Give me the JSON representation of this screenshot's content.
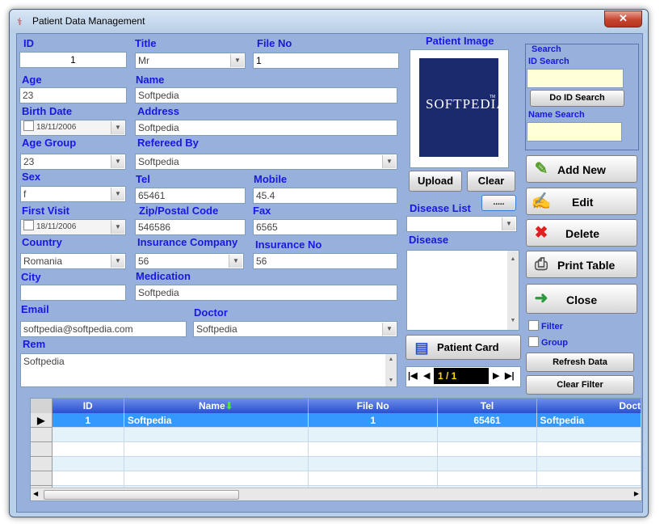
{
  "window": {
    "title": "Patient Data Management",
    "close_glyph": "✕"
  },
  "form": {
    "id": {
      "label": "ID",
      "value": "1"
    },
    "title": {
      "label": "Title",
      "value": "Mr"
    },
    "file_no": {
      "label": "File No",
      "value": "1"
    },
    "age": {
      "label": "Age",
      "value": "23"
    },
    "name": {
      "label": "Name",
      "value": "Softpedia"
    },
    "birth_date": {
      "label": "Birth Date",
      "value": "18/11/2006"
    },
    "address": {
      "label": "Address",
      "value": "Softpedia"
    },
    "age_group": {
      "label": "Age Group",
      "value": "23"
    },
    "refereed_by": {
      "label": "Refereed By",
      "value": "Softpedia"
    },
    "sex": {
      "label": "Sex",
      "value": "f"
    },
    "tel": {
      "label": "Tel",
      "value": "65461"
    },
    "mobile": {
      "label": "Mobile",
      "value": "45.4"
    },
    "first_visit": {
      "label": "First Visit",
      "value": "18/11/2006"
    },
    "zip": {
      "label": "Zip/Postal Code",
      "value": "546586"
    },
    "fax": {
      "label": "Fax",
      "value": "6565"
    },
    "country": {
      "label": "Country",
      "value": "Romania"
    },
    "insurance_company": {
      "label": "Insurance Company",
      "value": "56"
    },
    "insurance_no": {
      "label": "Insurance No",
      "value": "56"
    },
    "city": {
      "label": "City",
      "value": ""
    },
    "medication": {
      "label": "Medication",
      "value": "Softpedia"
    },
    "email": {
      "label": "Email",
      "value": "softpedia@softpedia.com"
    },
    "doctor": {
      "label": "Doctor",
      "value": "Softpedia"
    },
    "rem": {
      "label": "Rem",
      "value": "Softpedia"
    }
  },
  "patient_image": {
    "label": "Patient Image",
    "logo_text": "SOFTPEDIA",
    "logo_mark": "TM",
    "upload": "Upload",
    "clear": "Clear",
    "more": "....."
  },
  "disease": {
    "list_label": "Disease List",
    "label": "Disease",
    "list_value": ""
  },
  "patient_card": {
    "label": "Patient Card"
  },
  "navigator": {
    "page": "1 / 1"
  },
  "search": {
    "group_label": "Search",
    "id_label": "ID Search",
    "id_value": "",
    "do_id_search": "Do ID Search",
    "name_label": "Name Search",
    "name_value": ""
  },
  "actions": {
    "add_new": "Add New",
    "edit": "Edit",
    "delete": "Delete",
    "print_table": "Print Table",
    "close": "Close"
  },
  "filters": {
    "filter": "Filter",
    "group": "Group",
    "refresh": "Refresh Data",
    "clear_filter": "Clear Filter"
  },
  "grid": {
    "columns": [
      "ID",
      "Name",
      "File No",
      "Tel",
      "Doct"
    ],
    "rows": [
      [
        "1",
        "Softpedia",
        "1",
        "65461",
        "Softpedia"
      ]
    ]
  },
  "colors": {
    "label": "#1818e0",
    "client_bg": "#97b1dc",
    "header": "#2a4fd0",
    "selected_row": "#3399ff",
    "logo_bg": "#1a2a6c"
  }
}
